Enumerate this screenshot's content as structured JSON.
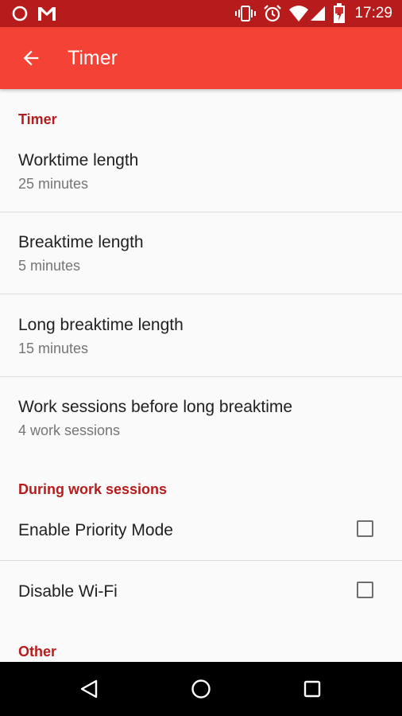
{
  "status_bar": {
    "time": "17:29",
    "icons": [
      "circle-notification-icon",
      "gmail-icon",
      "vibrate-icon",
      "alarm-icon",
      "wifi-icon",
      "signal-icon",
      "battery-charging-icon"
    ]
  },
  "app_bar": {
    "title": "Timer",
    "back_icon": "arrow-back-icon"
  },
  "sections": {
    "timer": {
      "header": "Timer",
      "items": [
        {
          "title": "Worktime length",
          "summary": "25 minutes"
        },
        {
          "title": "Breaktime length",
          "summary": "5 minutes"
        },
        {
          "title": "Long breaktime length",
          "summary": "15 minutes"
        },
        {
          "title": "Work sessions before long breaktime",
          "summary": "4 work sessions"
        }
      ]
    },
    "during_work": {
      "header": "During work sessions",
      "items": [
        {
          "title": "Enable Priority Mode",
          "checked": false
        },
        {
          "title": "Disable Wi-Fi",
          "checked": false
        }
      ]
    },
    "other": {
      "header": "Other"
    }
  },
  "nav_bar": {
    "icons": [
      "back-triangle-icon",
      "home-circle-icon",
      "recents-square-icon"
    ]
  },
  "colors": {
    "status_bar": "#b71c1c",
    "app_bar": "#f44336",
    "accent": "#b71c1c",
    "background": "#fafafa"
  }
}
